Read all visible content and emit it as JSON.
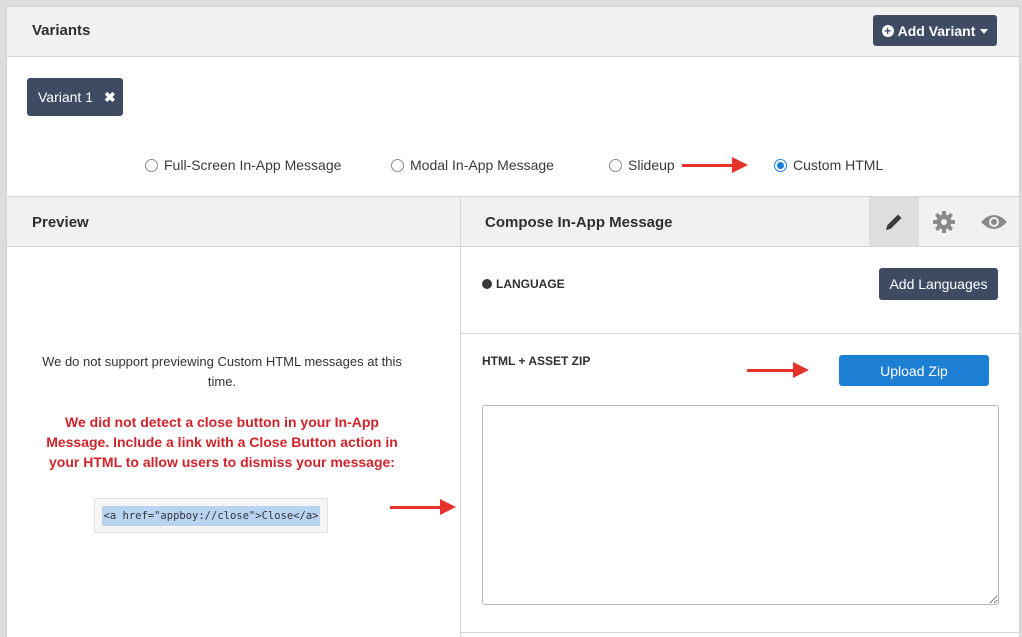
{
  "header": {
    "title": "Variants",
    "add_variant_label": "Add Variant"
  },
  "variant_tab": {
    "label": "Variant 1",
    "close_glyph": "✖"
  },
  "message_types": [
    {
      "label": "Full-Screen In-App Message",
      "selected": false
    },
    {
      "label": "Modal In-App Message",
      "selected": false
    },
    {
      "label": "Slideup",
      "selected": false
    },
    {
      "label": "Custom HTML",
      "selected": true
    }
  ],
  "preview": {
    "title": "Preview",
    "notice": "We do not support previewing Custom HTML messages at this time.",
    "warning": "We did not detect a close button in your In-App Message. Include a link with a Close Button action in your HTML to allow users to dismiss your message:",
    "code_snippet": "<a href=\"appboy://close\">Close</a>"
  },
  "compose": {
    "title": "Compose In-App Message",
    "tools": [
      "pencil-icon",
      "gear-icon",
      "eye-icon"
    ],
    "language_label": "LANGUAGE",
    "add_languages_label": "Add Languages",
    "zip_label": "HTML + ASSET ZIP",
    "upload_label": "Upload Zip",
    "html_value": ""
  },
  "colors": {
    "accent_blue": "#1d7fd4",
    "dark_button": "#3e4b63",
    "warning_red": "#d0242b",
    "annotation_arrow": "#e5332a"
  }
}
